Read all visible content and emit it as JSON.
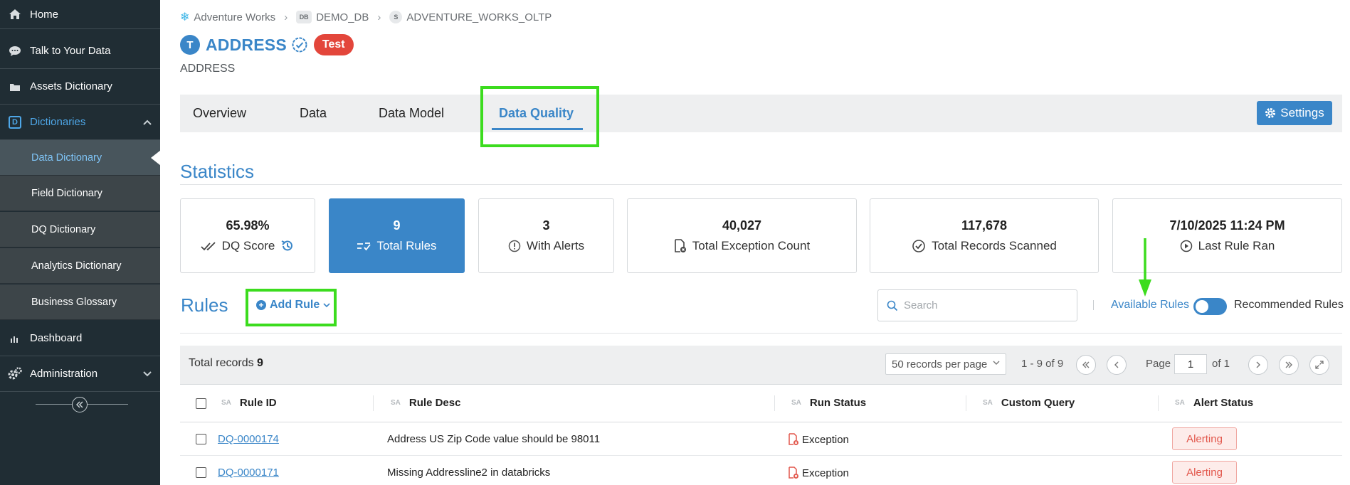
{
  "sidebar": {
    "items": [
      {
        "label": "Home",
        "icon": "home-icon"
      },
      {
        "label": "Talk to Your Data",
        "icon": "chat-icon"
      },
      {
        "label": "Assets Dictionary",
        "icon": "folder-icon"
      },
      {
        "label": "Dictionaries",
        "icon": "dictionary-icon"
      },
      {
        "label": "Dashboard",
        "icon": "bar-chart-icon"
      },
      {
        "label": "Administration",
        "icon": "gears-icon"
      }
    ],
    "sub_items": [
      {
        "label": "Data Dictionary"
      },
      {
        "label": "Field Dictionary"
      },
      {
        "label": "DQ Dictionary"
      },
      {
        "label": "Analytics Dictionary"
      },
      {
        "label": "Business Glossary"
      }
    ],
    "dictionary_tag": "D"
  },
  "breadcrumb": {
    "account": "Adventure Works",
    "database_tag": "DB",
    "database": "DEMO_DB",
    "schema_tag": "S",
    "schema": "ADVENTURE_WORKS_OLTP"
  },
  "header": {
    "type_badge": "T",
    "title": "ADDRESS",
    "env_badge": "Test",
    "subtitle": "ADDRESS"
  },
  "tabs": [
    {
      "label": "Overview"
    },
    {
      "label": "Data"
    },
    {
      "label": "Data Model"
    },
    {
      "label": "Data Quality",
      "active": true
    }
  ],
  "settings_label": "Settings",
  "statistics": {
    "title": "Statistics",
    "cards": [
      {
        "value": "65.98%",
        "label": "DQ Score"
      },
      {
        "value": "9",
        "label": "Total Rules"
      },
      {
        "value": "3",
        "label": "With Alerts"
      },
      {
        "value": "40,027",
        "label": "Total Exception Count"
      },
      {
        "value": "117,678",
        "label": "Total Records Scanned"
      },
      {
        "value": "7/10/2025 11:24 PM",
        "label": "Last Rule Ran"
      }
    ]
  },
  "rules": {
    "title": "Rules",
    "add_rule_label": "Add Rule",
    "search_placeholder": "Search",
    "available_rules_label": "Available Rules",
    "recommended_rules_label": "Recommended Rules",
    "toggle_recommended": false
  },
  "table": {
    "total_label": "Total records",
    "total_count": "9",
    "per_page": "50 records per page",
    "range": "1 - 9 of 9",
    "page_label": "Page",
    "page_value": "1",
    "of_label": "of 1",
    "sort_tag": "SA",
    "columns": [
      "Rule ID",
      "Rule Desc",
      "Run Status",
      "Custom Query",
      "Alert Status"
    ],
    "rows": [
      {
        "rule_id": "DQ-0000174",
        "rule_desc": "Address US Zip Code value should be 98011",
        "run_status": "Exception",
        "custom_query": "",
        "alert_status": "Alerting"
      },
      {
        "rule_id": "DQ-0000171",
        "rule_desc": "Missing Addressline2 in databricks",
        "run_status": "Exception",
        "custom_query": "",
        "alert_status": "Alerting"
      }
    ]
  },
  "colors": {
    "accent": "#3a86c8",
    "sidebar_bg": "#202d34",
    "highlight": "#3cdc1e",
    "alert": "#e2574c",
    "env_badge": "#e3463b"
  }
}
